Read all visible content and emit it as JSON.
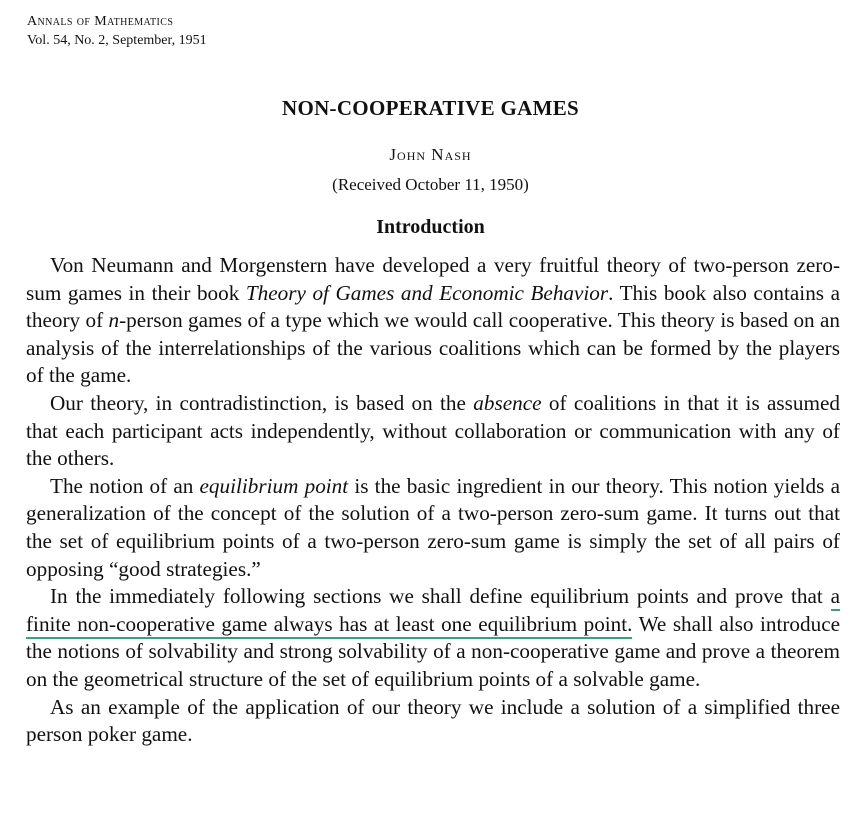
{
  "header": {
    "journal": "Annals of Mathematics",
    "issue": "Vol. 54, No. 2, September, 1951"
  },
  "title": "NON-COOPERATIVE GAMES",
  "author": "John Nash",
  "received": "(Received October 11, 1950)",
  "section_title": "Introduction",
  "paragraphs": {
    "p1": {
      "a": "Von Neumann and Morgenstern have developed a very fruitful theory of two-person zero-sum games in their book ",
      "book_title": "Theory of Games and Economic Behavior",
      "b": ". This book also contains a theory of ",
      "n": "n",
      "c": "-person games of a type which we would call cooperative. This theory is based on an analysis of the interrelationships of the various coalitions which can be formed by the players of the game."
    },
    "p2": {
      "a": "Our theory, in contradistinction, is based on the ",
      "absence": "absence",
      "b": " of coalitions in that it is assumed that each participant acts independently, without collaboration or communication with any of the others."
    },
    "p3": {
      "a": "The notion of an ",
      "term": "equilibrium point",
      "b": " is the basic ingredient in our theory. This notion yields a generalization of the concept of the solution of a two-person zero-sum game. It turns out that the set of equilibrium points of a two-person zero-sum game is simply the set of all pairs of opposing “good strategies.”"
    },
    "p4": {
      "a": "In the immediately following sections we shall define equilibrium points and prove that ",
      "highlight_1": "a finite non-cooperative game always has at least one equilibrium",
      "highlight_2": "point.",
      "b": " We shall also introduce the notions of solvability and strong solvability of a non-cooperative game and prove a theorem on the geometrical structure of the set of equilibrium points of a solvable game."
    },
    "p5": {
      "a": "As an example of the application of our theory we include a solution of a simplified three person poker game."
    }
  },
  "colors": {
    "highlight_underline": "#3a9e8a",
    "text": "#111111",
    "background": "#ffffff"
  }
}
